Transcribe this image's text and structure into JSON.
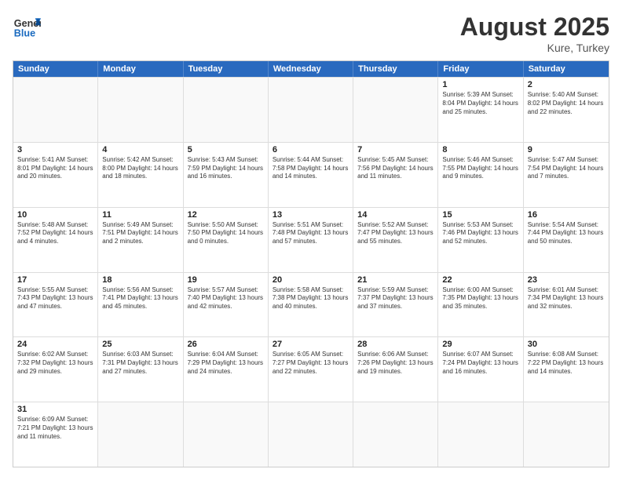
{
  "header": {
    "logo_general": "General",
    "logo_blue": "Blue",
    "month_year": "August 2025",
    "location": "Kure, Turkey"
  },
  "days_of_week": [
    "Sunday",
    "Monday",
    "Tuesday",
    "Wednesday",
    "Thursday",
    "Friday",
    "Saturday"
  ],
  "weeks": [
    [
      {
        "day": "",
        "info": ""
      },
      {
        "day": "",
        "info": ""
      },
      {
        "day": "",
        "info": ""
      },
      {
        "day": "",
        "info": ""
      },
      {
        "day": "",
        "info": ""
      },
      {
        "day": "1",
        "info": "Sunrise: 5:39 AM\nSunset: 8:04 PM\nDaylight: 14 hours and 25 minutes."
      },
      {
        "day": "2",
        "info": "Sunrise: 5:40 AM\nSunset: 8:02 PM\nDaylight: 14 hours and 22 minutes."
      }
    ],
    [
      {
        "day": "3",
        "info": "Sunrise: 5:41 AM\nSunset: 8:01 PM\nDaylight: 14 hours and 20 minutes."
      },
      {
        "day": "4",
        "info": "Sunrise: 5:42 AM\nSunset: 8:00 PM\nDaylight: 14 hours and 18 minutes."
      },
      {
        "day": "5",
        "info": "Sunrise: 5:43 AM\nSunset: 7:59 PM\nDaylight: 14 hours and 16 minutes."
      },
      {
        "day": "6",
        "info": "Sunrise: 5:44 AM\nSunset: 7:58 PM\nDaylight: 14 hours and 14 minutes."
      },
      {
        "day": "7",
        "info": "Sunrise: 5:45 AM\nSunset: 7:56 PM\nDaylight: 14 hours and 11 minutes."
      },
      {
        "day": "8",
        "info": "Sunrise: 5:46 AM\nSunset: 7:55 PM\nDaylight: 14 hours and 9 minutes."
      },
      {
        "day": "9",
        "info": "Sunrise: 5:47 AM\nSunset: 7:54 PM\nDaylight: 14 hours and 7 minutes."
      }
    ],
    [
      {
        "day": "10",
        "info": "Sunrise: 5:48 AM\nSunset: 7:52 PM\nDaylight: 14 hours and 4 minutes."
      },
      {
        "day": "11",
        "info": "Sunrise: 5:49 AM\nSunset: 7:51 PM\nDaylight: 14 hours and 2 minutes."
      },
      {
        "day": "12",
        "info": "Sunrise: 5:50 AM\nSunset: 7:50 PM\nDaylight: 14 hours and 0 minutes."
      },
      {
        "day": "13",
        "info": "Sunrise: 5:51 AM\nSunset: 7:48 PM\nDaylight: 13 hours and 57 minutes."
      },
      {
        "day": "14",
        "info": "Sunrise: 5:52 AM\nSunset: 7:47 PM\nDaylight: 13 hours and 55 minutes."
      },
      {
        "day": "15",
        "info": "Sunrise: 5:53 AM\nSunset: 7:46 PM\nDaylight: 13 hours and 52 minutes."
      },
      {
        "day": "16",
        "info": "Sunrise: 5:54 AM\nSunset: 7:44 PM\nDaylight: 13 hours and 50 minutes."
      }
    ],
    [
      {
        "day": "17",
        "info": "Sunrise: 5:55 AM\nSunset: 7:43 PM\nDaylight: 13 hours and 47 minutes."
      },
      {
        "day": "18",
        "info": "Sunrise: 5:56 AM\nSunset: 7:41 PM\nDaylight: 13 hours and 45 minutes."
      },
      {
        "day": "19",
        "info": "Sunrise: 5:57 AM\nSunset: 7:40 PM\nDaylight: 13 hours and 42 minutes."
      },
      {
        "day": "20",
        "info": "Sunrise: 5:58 AM\nSunset: 7:38 PM\nDaylight: 13 hours and 40 minutes."
      },
      {
        "day": "21",
        "info": "Sunrise: 5:59 AM\nSunset: 7:37 PM\nDaylight: 13 hours and 37 minutes."
      },
      {
        "day": "22",
        "info": "Sunrise: 6:00 AM\nSunset: 7:35 PM\nDaylight: 13 hours and 35 minutes."
      },
      {
        "day": "23",
        "info": "Sunrise: 6:01 AM\nSunset: 7:34 PM\nDaylight: 13 hours and 32 minutes."
      }
    ],
    [
      {
        "day": "24",
        "info": "Sunrise: 6:02 AM\nSunset: 7:32 PM\nDaylight: 13 hours and 29 minutes."
      },
      {
        "day": "25",
        "info": "Sunrise: 6:03 AM\nSunset: 7:31 PM\nDaylight: 13 hours and 27 minutes."
      },
      {
        "day": "26",
        "info": "Sunrise: 6:04 AM\nSunset: 7:29 PM\nDaylight: 13 hours and 24 minutes."
      },
      {
        "day": "27",
        "info": "Sunrise: 6:05 AM\nSunset: 7:27 PM\nDaylight: 13 hours and 22 minutes."
      },
      {
        "day": "28",
        "info": "Sunrise: 6:06 AM\nSunset: 7:26 PM\nDaylight: 13 hours and 19 minutes."
      },
      {
        "day": "29",
        "info": "Sunrise: 6:07 AM\nSunset: 7:24 PM\nDaylight: 13 hours and 16 minutes."
      },
      {
        "day": "30",
        "info": "Sunrise: 6:08 AM\nSunset: 7:22 PM\nDaylight: 13 hours and 14 minutes."
      }
    ],
    [
      {
        "day": "31",
        "info": "Sunrise: 6:09 AM\nSunset: 7:21 PM\nDaylight: 13 hours and 11 minutes."
      },
      {
        "day": "",
        "info": ""
      },
      {
        "day": "",
        "info": ""
      },
      {
        "day": "",
        "info": ""
      },
      {
        "day": "",
        "info": ""
      },
      {
        "day": "",
        "info": ""
      },
      {
        "day": "",
        "info": ""
      }
    ]
  ]
}
